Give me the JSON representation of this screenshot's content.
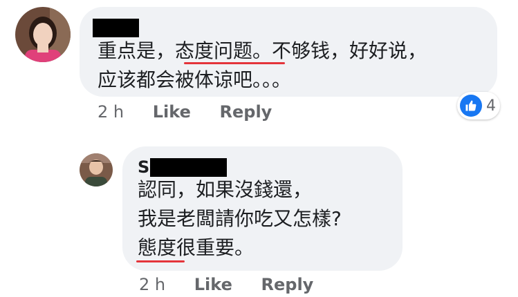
{
  "comment": {
    "avatar_icon": "profile-photo-woman",
    "lines": [
      "重点是，态度问题。不够钱，好好说，",
      "应该都会被体谅吧。。。"
    ],
    "time": "2 h",
    "like_label": "Like",
    "reply_label": "Reply",
    "reaction_icon": "thumbs-up-icon",
    "reaction_count": "4"
  },
  "reply": {
    "avatar_icon": "profile-photo-man",
    "author_initial": "S",
    "lines": [
      "認同，如果沒錢還，",
      "我是老闆請你吃又怎樣?",
      "態度很重要。"
    ],
    "time": "2 h",
    "like_label": "Like",
    "reply_label": "Reply"
  },
  "colors": {
    "bubble": "#f0f2f5",
    "underline": "#e4343a",
    "like_blue": "#1877f2",
    "meta_gray": "#65676b"
  }
}
